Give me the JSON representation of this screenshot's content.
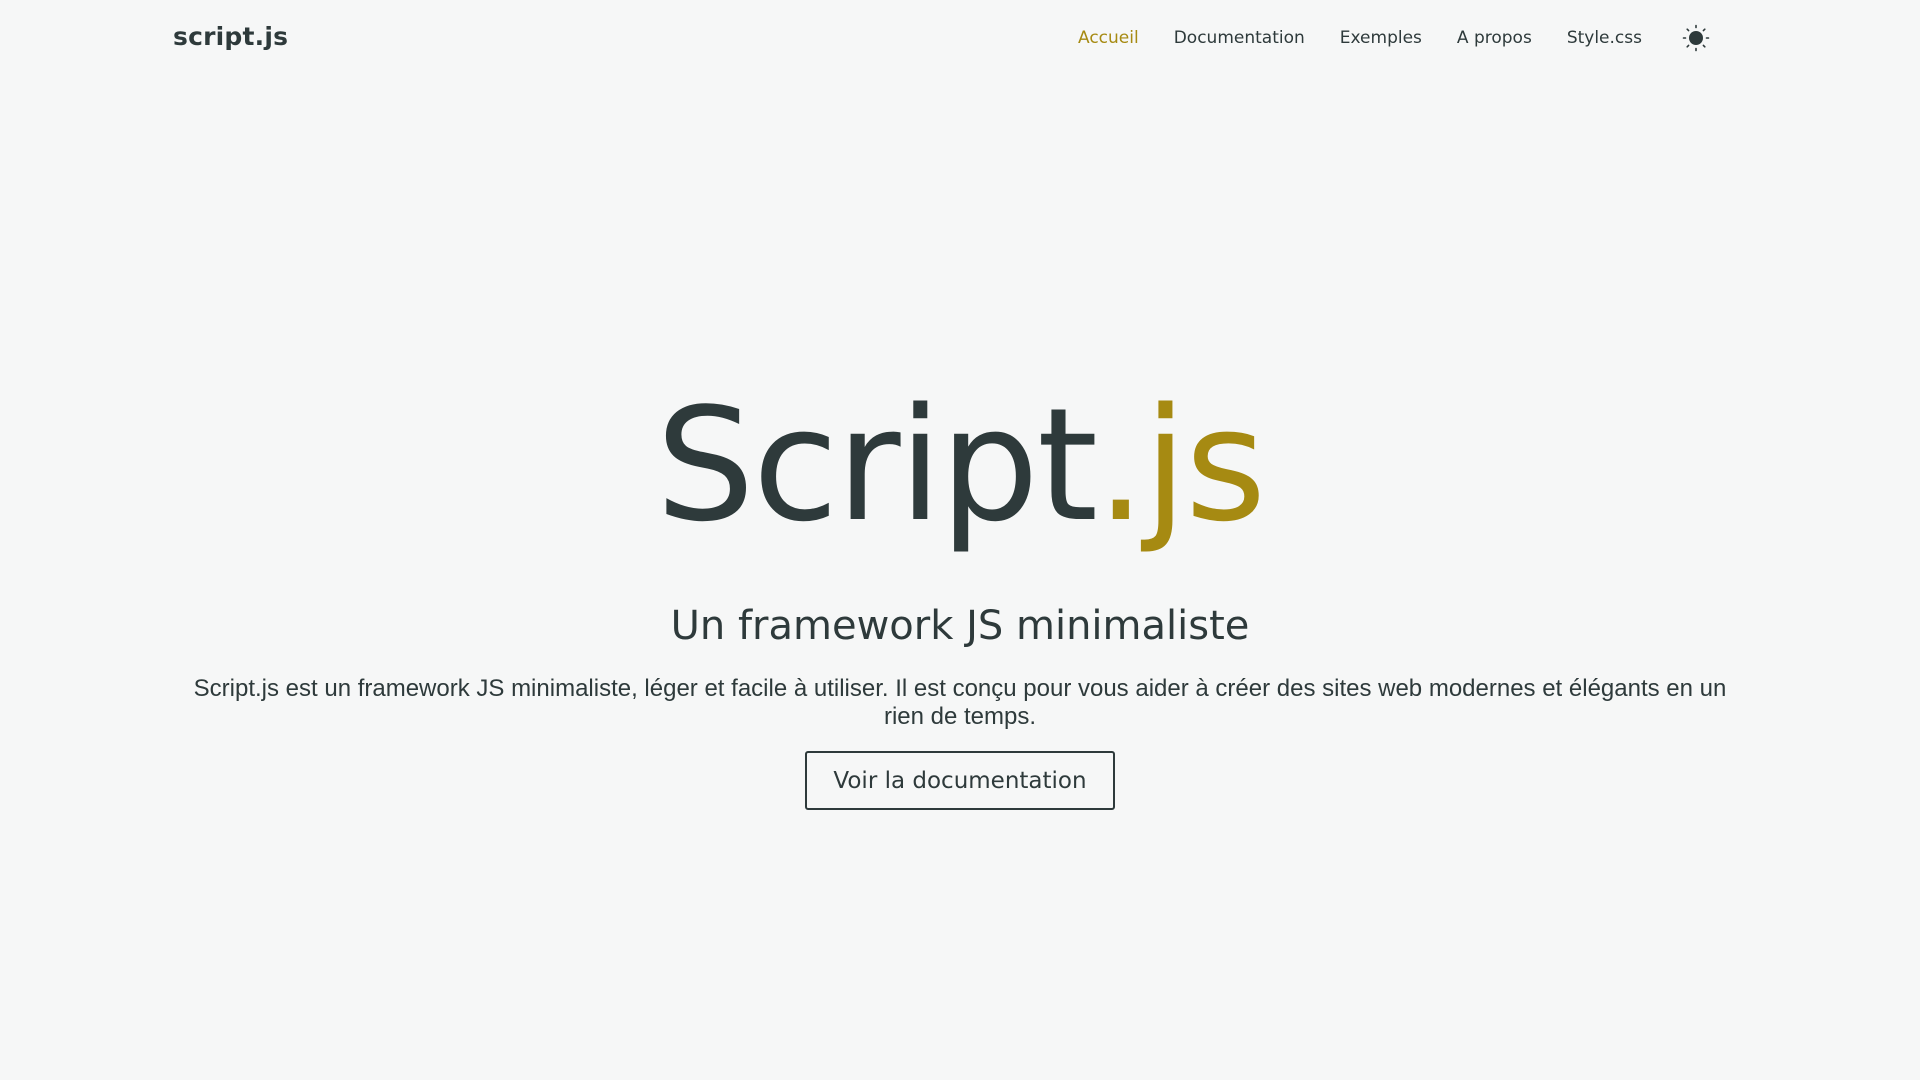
{
  "navbar": {
    "brand": "script.js",
    "links": [
      {
        "label": "Accueil",
        "active": true
      },
      {
        "label": "Documentation",
        "active": false
      },
      {
        "label": "Exemples",
        "active": false
      },
      {
        "label": "A propos",
        "active": false
      },
      {
        "label": "Style.css",
        "active": false
      }
    ],
    "theme_toggle_icon": "sun-icon"
  },
  "hero": {
    "title_main": "Script",
    "title_accent": ".js",
    "subtitle": "Un framework JS minimaliste",
    "description": "Script.js est un framework JS minimaliste, léger et facile à utiliser. Il est conçu pour vous aider à créer des sites web modernes et élégants en un rien de temps.",
    "cta_label": "Voir la documentation"
  },
  "colors": {
    "background": "#f6f7f7",
    "text": "#2e3a3b",
    "accent": "#a68a12"
  }
}
